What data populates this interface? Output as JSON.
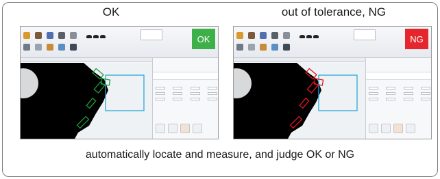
{
  "panels": [
    {
      "title": "OK",
      "badge": "OK",
      "badge_color": "#3db049",
      "overlay_color": "#1f9d3a",
      "measure_box_color": "#2aa7d8",
      "app": {
        "window_title": "",
        "info_line": "",
        "subbar_text": ""
      }
    },
    {
      "title": "out of tolerance, NG",
      "badge": "NG",
      "badge_color": "#e5272d",
      "overlay_color": "#e0151b",
      "measure_box_color": "#2aa7d8",
      "app": {
        "window_title": "",
        "info_line": "",
        "subbar_text": ""
      }
    }
  ],
  "caption": "automatically locate and measure, and judge OK or NG",
  "toolbar_icons": [
    "folder-icon",
    "user-icon",
    "save-icon",
    "print-icon",
    "camera-icon"
  ],
  "toolbar_icons_row2": [
    "edit-icon",
    "pointer-icon",
    "eraser-icon",
    "ruler-icon",
    "pen-icon"
  ],
  "colors": {
    "frame_border": "#7a7a7a",
    "ok_green": "#3db049",
    "ng_red": "#e5272d",
    "measure_blue": "#2aa7d8"
  }
}
